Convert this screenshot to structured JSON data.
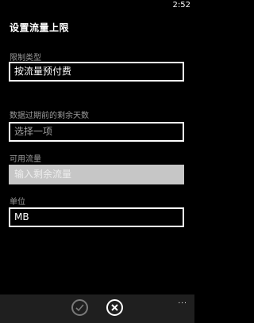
{
  "status_bar": {
    "time": "2:52"
  },
  "page": {
    "title": "设置流量上限"
  },
  "fields": {
    "limit_type": {
      "label": "限制类型",
      "value": "按流量预付费"
    },
    "days_left": {
      "label": "数据过期前的剩余天数",
      "placeholder": "选择一项"
    },
    "available": {
      "label": "可用流量",
      "placeholder": "输入剩余流量"
    },
    "unit": {
      "label": "单位",
      "value": "MB"
    }
  },
  "app_bar": {
    "more": "..."
  }
}
